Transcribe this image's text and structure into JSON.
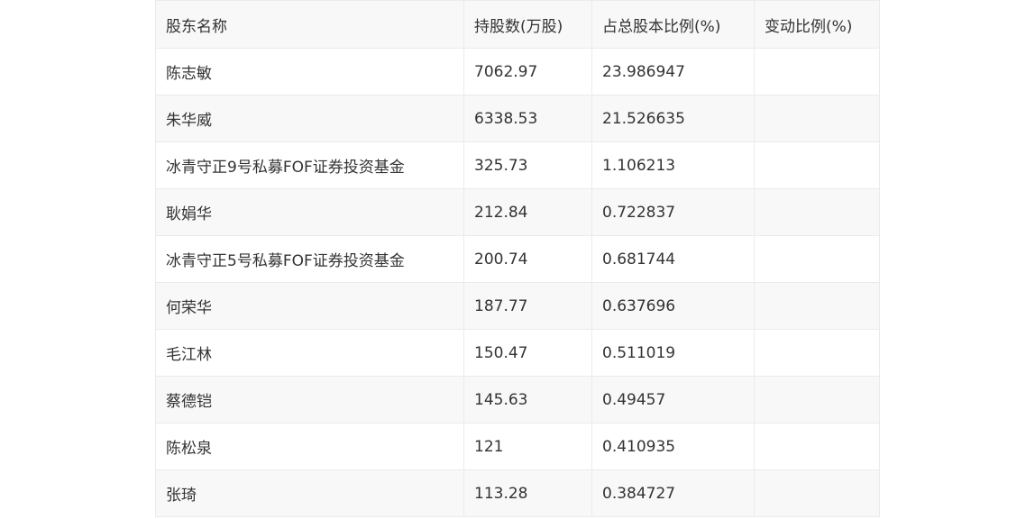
{
  "table": {
    "headers": [
      "股东名称",
      "持股数(万股)",
      "占总股本比例(%)",
      "变动比例(%)"
    ],
    "rows": [
      [
        "陈志敏",
        "7062.97",
        "23.986947",
        ""
      ],
      [
        "朱华威",
        "6338.53",
        "21.526635",
        ""
      ],
      [
        "冰青守正9号私募FOF证券投资基金",
        "325.73",
        "1.106213",
        ""
      ],
      [
        "耿娟华",
        "212.84",
        "0.722837",
        ""
      ],
      [
        "冰青守正5号私募FOF证券投资基金",
        "200.74",
        "0.681744",
        ""
      ],
      [
        "何荣华",
        "187.77",
        "0.637696",
        ""
      ],
      [
        "毛江林",
        "150.47",
        "0.511019",
        ""
      ],
      [
        "蔡德铠",
        "145.63",
        "0.49457",
        ""
      ],
      [
        "陈松泉",
        "121",
        "0.410935",
        ""
      ],
      [
        "张琦",
        "113.28",
        "0.384727",
        ""
      ]
    ]
  }
}
